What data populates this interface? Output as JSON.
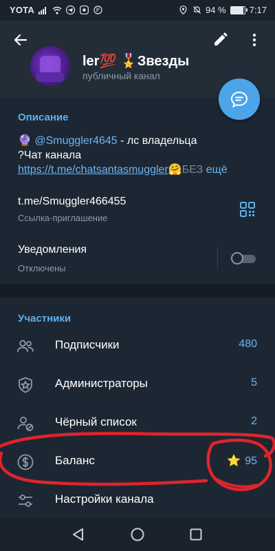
{
  "status_bar": {
    "carrier": "YOTA",
    "battery_percent": "94 %",
    "battery_level": 0.94,
    "time": "7:17"
  },
  "header": {
    "title": "ler💯 🎖️Звезды",
    "subtitle": "публичный канал",
    "icons": [
      "arrow-left-icon",
      "pencil-icon",
      "more-vertical-icon",
      "chat-bubble-icon"
    ]
  },
  "description": {
    "heading": "Описание",
    "line1_emoji": "🔮",
    "line1_mention": "@Smuggler4645",
    "line1_text": " - лс владельца",
    "line2": "?Чат канала",
    "line3_link": "https://t.me/chatsantasmuggler",
    "line3_emoji": "🤗",
    "line3_faded": "БЕЗ",
    "line3_more": "ещё"
  },
  "invite": {
    "link": "t.me/Smuggler466455",
    "label": "Ссылка-приглашение"
  },
  "notifications": {
    "title": "Уведомления",
    "status": "Отключены",
    "enabled": false
  },
  "members": {
    "heading": "Участники",
    "rows": [
      {
        "label": "Подписчики",
        "value": "480",
        "icon": "people-icon"
      },
      {
        "label": "Администраторы",
        "value": "5",
        "icon": "admin-shield-icon"
      },
      {
        "label": "Чёрный список",
        "value": "2",
        "icon": "blocked-user-icon"
      },
      {
        "label": "Баланс",
        "value": "95",
        "icon": "dollar-coin-icon",
        "value_prefix": "⭐"
      },
      {
        "label": "Настройки канала",
        "value": "",
        "icon": "settings-sliders-icon"
      }
    ]
  },
  "colors": {
    "accent": "#5fb0ee",
    "fab": "#4ca5e9",
    "annotation": "#e0242c"
  }
}
